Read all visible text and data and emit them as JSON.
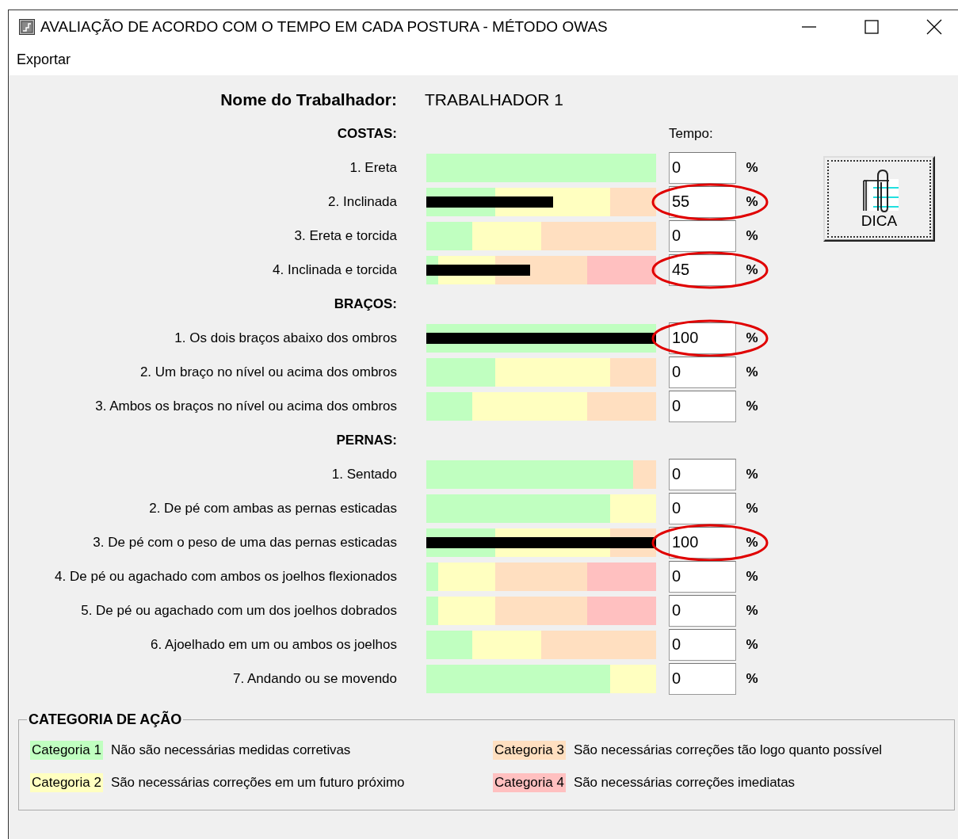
{
  "window": {
    "title": "AVALIAÇÃO DE ACORDO COM O TEMPO EM CADA POSTURA - MÉTODO OWAS"
  },
  "menu": [
    "Exportar"
  ],
  "worker": {
    "label": "Nome do Trabalhador:",
    "value": "TRABALHADOR 1"
  },
  "time_header": "Tempo:",
  "sections": [
    {
      "title": "COSTAS:",
      "rows": [
        {
          "label": "1. Ereta",
          "bands": [
            {
              "color": "#c0ffc0"
            },
            {
              "color": "#c0ffc0"
            },
            {
              "color": "#c0ffc0"
            },
            {
              "color": "#c0ffc0"
            },
            {
              "color": "#c0ffc0"
            },
            {
              "color": "#c0ffc0"
            },
            {
              "color": "#c0ffc0"
            },
            {
              "color": "#c0ffc0"
            },
            {
              "color": "#c0ffc0"
            },
            {
              "color": "#c0ffc0"
            },
            {
              "color": "#c0ffc0"
            },
            {
              "color": "#c0ffc0"
            },
            {
              "color": "#c0ffc0"
            },
            {
              "color": "#c0ffc0"
            },
            {
              "color": "#c0ffc0"
            },
            {
              "color": "#c0ffc0"
            },
            {
              "color": "#c0ffc0"
            },
            {
              "color": "#c0ffc0"
            },
            {
              "color": "#c0ffc0"
            },
            {
              "color": "#c0ffc0"
            }
          ],
          "value": "0",
          "unit": "%"
        },
        {
          "label": "2. Inclinada",
          "bands": [
            {
              "color": "#c0ffc0"
            },
            {
              "color": "#c0ffc0"
            },
            {
              "color": "#c0ffc0"
            },
            {
              "color": "#c0ffc0"
            },
            {
              "color": "#c0ffc0"
            },
            {
              "color": "#c0ffc0"
            },
            {
              "color": "#ffffc0"
            },
            {
              "color": "#ffffc0"
            },
            {
              "color": "#ffffc0"
            },
            {
              "color": "#ffffc0"
            },
            {
              "color": "#ffffc0"
            },
            {
              "color": "#ffffc0"
            },
            {
              "color": "#ffffc0"
            },
            {
              "color": "#ffffc0"
            },
            {
              "color": "#ffffc0"
            },
            {
              "color": "#ffffc0"
            },
            {
              "color": "#ffdfc0"
            },
            {
              "color": "#ffdfc0"
            },
            {
              "color": "#ffdfc0"
            },
            {
              "color": "#ffdfc0"
            }
          ],
          "value": "55",
          "unit": "%",
          "highlighted": true
        },
        {
          "label": "3. Ereta e torcida",
          "bands": [
            {
              "color": "#c0ffc0"
            },
            {
              "color": "#c0ffc0"
            },
            {
              "color": "#c0ffc0"
            },
            {
              "color": "#c0ffc0"
            },
            {
              "color": "#ffffc0"
            },
            {
              "color": "#ffffc0"
            },
            {
              "color": "#ffffc0"
            },
            {
              "color": "#ffffc0"
            },
            {
              "color": "#ffffc0"
            },
            {
              "color": "#ffffc0"
            },
            {
              "color": "#ffdfc0"
            },
            {
              "color": "#ffdfc0"
            },
            {
              "color": "#ffdfc0"
            },
            {
              "color": "#ffdfc0"
            },
            {
              "color": "#ffdfc0"
            },
            {
              "color": "#ffdfc0"
            },
            {
              "color": "#ffdfc0"
            },
            {
              "color": "#ffdfc0"
            },
            {
              "color": "#ffdfc0"
            },
            {
              "color": "#ffdfc0"
            }
          ],
          "value": "0",
          "unit": "%"
        },
        {
          "label": "4. Inclinada e torcida",
          "bands": [
            {
              "color": "#c0ffc0"
            },
            {
              "color": "#ffffc0"
            },
            {
              "color": "#ffffc0"
            },
            {
              "color": "#ffffc0"
            },
            {
              "color": "#ffffc0"
            },
            {
              "color": "#ffffc0"
            },
            {
              "color": "#ffdfc0"
            },
            {
              "color": "#ffdfc0"
            },
            {
              "color": "#ffdfc0"
            },
            {
              "color": "#ffdfc0"
            },
            {
              "color": "#ffdfc0"
            },
            {
              "color": "#ffdfc0"
            },
            {
              "color": "#ffdfc0"
            },
            {
              "color": "#ffdfc0"
            },
            {
              "color": "#ffc0c0"
            },
            {
              "color": "#ffc0c0"
            },
            {
              "color": "#ffc0c0"
            },
            {
              "color": "#ffc0c0"
            },
            {
              "color": "#ffc0c0"
            },
            {
              "color": "#ffc0c0"
            }
          ],
          "value": "45",
          "unit": "%",
          "highlighted": true
        }
      ]
    },
    {
      "title": "BRAÇOS:",
      "rows": [
        {
          "label": "1. Os dois braços abaixo dos ombros",
          "bands": [
            {
              "color": "#c0ffc0"
            },
            {
              "color": "#c0ffc0"
            },
            {
              "color": "#c0ffc0"
            },
            {
              "color": "#c0ffc0"
            },
            {
              "color": "#c0ffc0"
            },
            {
              "color": "#c0ffc0"
            },
            {
              "color": "#c0ffc0"
            },
            {
              "color": "#c0ffc0"
            },
            {
              "color": "#c0ffc0"
            },
            {
              "color": "#c0ffc0"
            },
            {
              "color": "#c0ffc0"
            },
            {
              "color": "#c0ffc0"
            },
            {
              "color": "#c0ffc0"
            },
            {
              "color": "#c0ffc0"
            },
            {
              "color": "#c0ffc0"
            },
            {
              "color": "#c0ffc0"
            },
            {
              "color": "#c0ffc0"
            },
            {
              "color": "#c0ffc0"
            },
            {
              "color": "#c0ffc0"
            },
            {
              "color": "#c0ffc0"
            }
          ],
          "value": "100",
          "unit": "%",
          "highlighted": true
        },
        {
          "label": "2. Um braço no nível ou acima dos ombros",
          "bands": [
            {
              "color": "#c0ffc0"
            },
            {
              "color": "#c0ffc0"
            },
            {
              "color": "#c0ffc0"
            },
            {
              "color": "#c0ffc0"
            },
            {
              "color": "#c0ffc0"
            },
            {
              "color": "#c0ffc0"
            },
            {
              "color": "#ffffc0"
            },
            {
              "color": "#ffffc0"
            },
            {
              "color": "#ffffc0"
            },
            {
              "color": "#ffffc0"
            },
            {
              "color": "#ffffc0"
            },
            {
              "color": "#ffffc0"
            },
            {
              "color": "#ffffc0"
            },
            {
              "color": "#ffffc0"
            },
            {
              "color": "#ffffc0"
            },
            {
              "color": "#ffffc0"
            },
            {
              "color": "#ffdfc0"
            },
            {
              "color": "#ffdfc0"
            },
            {
              "color": "#ffdfc0"
            },
            {
              "color": "#ffdfc0"
            }
          ],
          "value": "0",
          "unit": "%"
        },
        {
          "label": "3. Ambos os braços no nível ou acima dos ombros",
          "bands": [
            {
              "color": "#c0ffc0"
            },
            {
              "color": "#c0ffc0"
            },
            {
              "color": "#c0ffc0"
            },
            {
              "color": "#c0ffc0"
            },
            {
              "color": "#ffffc0"
            },
            {
              "color": "#ffffc0"
            },
            {
              "color": "#ffffc0"
            },
            {
              "color": "#ffffc0"
            },
            {
              "color": "#ffffc0"
            },
            {
              "color": "#ffffc0"
            },
            {
              "color": "#ffffc0"
            },
            {
              "color": "#ffffc0"
            },
            {
              "color": "#ffffc0"
            },
            {
              "color": "#ffffc0"
            },
            {
              "color": "#ffdfc0"
            },
            {
              "color": "#ffdfc0"
            },
            {
              "color": "#ffdfc0"
            },
            {
              "color": "#ffdfc0"
            },
            {
              "color": "#ffdfc0"
            },
            {
              "color": "#ffdfc0"
            }
          ],
          "value": "0",
          "unit": "%"
        }
      ]
    },
    {
      "title": "PERNAS:",
      "rows": [
        {
          "label": "1. Sentado",
          "bands": [
            {
              "color": "#c0ffc0"
            },
            {
              "color": "#c0ffc0"
            },
            {
              "color": "#c0ffc0"
            },
            {
              "color": "#c0ffc0"
            },
            {
              "color": "#c0ffc0"
            },
            {
              "color": "#c0ffc0"
            },
            {
              "color": "#c0ffc0"
            },
            {
              "color": "#c0ffc0"
            },
            {
              "color": "#c0ffc0"
            },
            {
              "color": "#c0ffc0"
            },
            {
              "color": "#c0ffc0"
            },
            {
              "color": "#c0ffc0"
            },
            {
              "color": "#c0ffc0"
            },
            {
              "color": "#c0ffc0"
            },
            {
              "color": "#c0ffc0"
            },
            {
              "color": "#c0ffc0"
            },
            {
              "color": "#c0ffc0"
            },
            {
              "color": "#c0ffc0"
            },
            {
              "color": "#ffdfc0"
            },
            {
              "color": "#ffdfc0"
            }
          ],
          "value": "0",
          "unit": "%"
        },
        {
          "label": "2. De pé com ambas as pernas esticadas",
          "bands": [
            {
              "color": "#c0ffc0"
            },
            {
              "color": "#c0ffc0"
            },
            {
              "color": "#c0ffc0"
            },
            {
              "color": "#c0ffc0"
            },
            {
              "color": "#c0ffc0"
            },
            {
              "color": "#c0ffc0"
            },
            {
              "color": "#c0ffc0"
            },
            {
              "color": "#c0ffc0"
            },
            {
              "color": "#c0ffc0"
            },
            {
              "color": "#c0ffc0"
            },
            {
              "color": "#c0ffc0"
            },
            {
              "color": "#c0ffc0"
            },
            {
              "color": "#c0ffc0"
            },
            {
              "color": "#c0ffc0"
            },
            {
              "color": "#c0ffc0"
            },
            {
              "color": "#c0ffc0"
            },
            {
              "color": "#ffffc0"
            },
            {
              "color": "#ffffc0"
            },
            {
              "color": "#ffffc0"
            },
            {
              "color": "#ffffc0"
            }
          ],
          "value": "0",
          "unit": "%"
        },
        {
          "label": "3. De pé com o peso de uma das pernas esticadas",
          "bands": [
            {
              "color": "#c0ffc0"
            },
            {
              "color": "#c0ffc0"
            },
            {
              "color": "#c0ffc0"
            },
            {
              "color": "#c0ffc0"
            },
            {
              "color": "#c0ffc0"
            },
            {
              "color": "#c0ffc0"
            },
            {
              "color": "#ffffc0"
            },
            {
              "color": "#ffffc0"
            },
            {
              "color": "#ffffc0"
            },
            {
              "color": "#ffffc0"
            },
            {
              "color": "#ffffc0"
            },
            {
              "color": "#ffffc0"
            },
            {
              "color": "#ffffc0"
            },
            {
              "color": "#ffffc0"
            },
            {
              "color": "#ffffc0"
            },
            {
              "color": "#ffffc0"
            },
            {
              "color": "#ffdfc0"
            },
            {
              "color": "#ffdfc0"
            },
            {
              "color": "#ffdfc0"
            },
            {
              "color": "#ffdfc0"
            }
          ],
          "value": "100",
          "unit": "%",
          "highlighted": true
        },
        {
          "label": "4. De pé ou agachado com ambos os joelhos flexionados",
          "bands": [
            {
              "color": "#c0ffc0"
            },
            {
              "color": "#ffffc0"
            },
            {
              "color": "#ffffc0"
            },
            {
              "color": "#ffffc0"
            },
            {
              "color": "#ffffc0"
            },
            {
              "color": "#ffffc0"
            },
            {
              "color": "#ffdfc0"
            },
            {
              "color": "#ffdfc0"
            },
            {
              "color": "#ffdfc0"
            },
            {
              "color": "#ffdfc0"
            },
            {
              "color": "#ffdfc0"
            },
            {
              "color": "#ffdfc0"
            },
            {
              "color": "#ffdfc0"
            },
            {
              "color": "#ffdfc0"
            },
            {
              "color": "#ffc0c0"
            },
            {
              "color": "#ffc0c0"
            },
            {
              "color": "#ffc0c0"
            },
            {
              "color": "#ffc0c0"
            },
            {
              "color": "#ffc0c0"
            },
            {
              "color": "#ffc0c0"
            }
          ],
          "value": "0",
          "unit": "%"
        },
        {
          "label": "5. De pé ou agachado com um dos joelhos dobrados",
          "bands": [
            {
              "color": "#c0ffc0"
            },
            {
              "color": "#ffffc0"
            },
            {
              "color": "#ffffc0"
            },
            {
              "color": "#ffffc0"
            },
            {
              "color": "#ffffc0"
            },
            {
              "color": "#ffffc0"
            },
            {
              "color": "#ffdfc0"
            },
            {
              "color": "#ffdfc0"
            },
            {
              "color": "#ffdfc0"
            },
            {
              "color": "#ffdfc0"
            },
            {
              "color": "#ffdfc0"
            },
            {
              "color": "#ffdfc0"
            },
            {
              "color": "#ffdfc0"
            },
            {
              "color": "#ffdfc0"
            },
            {
              "color": "#ffc0c0"
            },
            {
              "color": "#ffc0c0"
            },
            {
              "color": "#ffc0c0"
            },
            {
              "color": "#ffc0c0"
            },
            {
              "color": "#ffc0c0"
            },
            {
              "color": "#ffc0c0"
            }
          ],
          "value": "0",
          "unit": "%"
        },
        {
          "label": "6. Ajoelhado em um ou ambos os joelhos",
          "bands": [
            {
              "color": "#c0ffc0"
            },
            {
              "color": "#c0ffc0"
            },
            {
              "color": "#c0ffc0"
            },
            {
              "color": "#c0ffc0"
            },
            {
              "color": "#ffffc0"
            },
            {
              "color": "#ffffc0"
            },
            {
              "color": "#ffffc0"
            },
            {
              "color": "#ffffc0"
            },
            {
              "color": "#ffffc0"
            },
            {
              "color": "#ffffc0"
            },
            {
              "color": "#ffdfc0"
            },
            {
              "color": "#ffdfc0"
            },
            {
              "color": "#ffdfc0"
            },
            {
              "color": "#ffdfc0"
            },
            {
              "color": "#ffdfc0"
            },
            {
              "color": "#ffdfc0"
            },
            {
              "color": "#ffdfc0"
            },
            {
              "color": "#ffdfc0"
            },
            {
              "color": "#ffdfc0"
            },
            {
              "color": "#ffdfc0"
            }
          ],
          "value": "0",
          "unit": "%"
        },
        {
          "label": "7. Andando ou se movendo",
          "bands": [
            {
              "color": "#c0ffc0"
            },
            {
              "color": "#c0ffc0"
            },
            {
              "color": "#c0ffc0"
            },
            {
              "color": "#c0ffc0"
            },
            {
              "color": "#c0ffc0"
            },
            {
              "color": "#c0ffc0"
            },
            {
              "color": "#c0ffc0"
            },
            {
              "color": "#c0ffc0"
            },
            {
              "color": "#c0ffc0"
            },
            {
              "color": "#c0ffc0"
            },
            {
              "color": "#c0ffc0"
            },
            {
              "color": "#c0ffc0"
            },
            {
              "color": "#c0ffc0"
            },
            {
              "color": "#c0ffc0"
            },
            {
              "color": "#c0ffc0"
            },
            {
              "color": "#c0ffc0"
            },
            {
              "color": "#ffffc0"
            },
            {
              "color": "#ffffc0"
            },
            {
              "color": "#ffffc0"
            },
            {
              "color": "#ffffc0"
            }
          ],
          "value": "0",
          "unit": "%"
        }
      ]
    }
  ],
  "tip_button": {
    "label": "DICA"
  },
  "legend": {
    "title": "CATEGORIA DE AÇÃO",
    "items": [
      {
        "badge": "Categoria 1",
        "text": "Não são necessárias medidas corretivas",
        "color": "#c0ffc0"
      },
      {
        "badge": "Categoria 3",
        "text": "São necessárias correções tão logo quanto possível",
        "color": "#ffdfc0"
      },
      {
        "badge": "Categoria 2",
        "text": "São necessárias correções em um futuro próximo",
        "color": "#ffffc0"
      },
      {
        "badge": "Categoria 4",
        "text": "São necessárias correções imediatas",
        "color": "#ffc0c0"
      }
    ]
  }
}
